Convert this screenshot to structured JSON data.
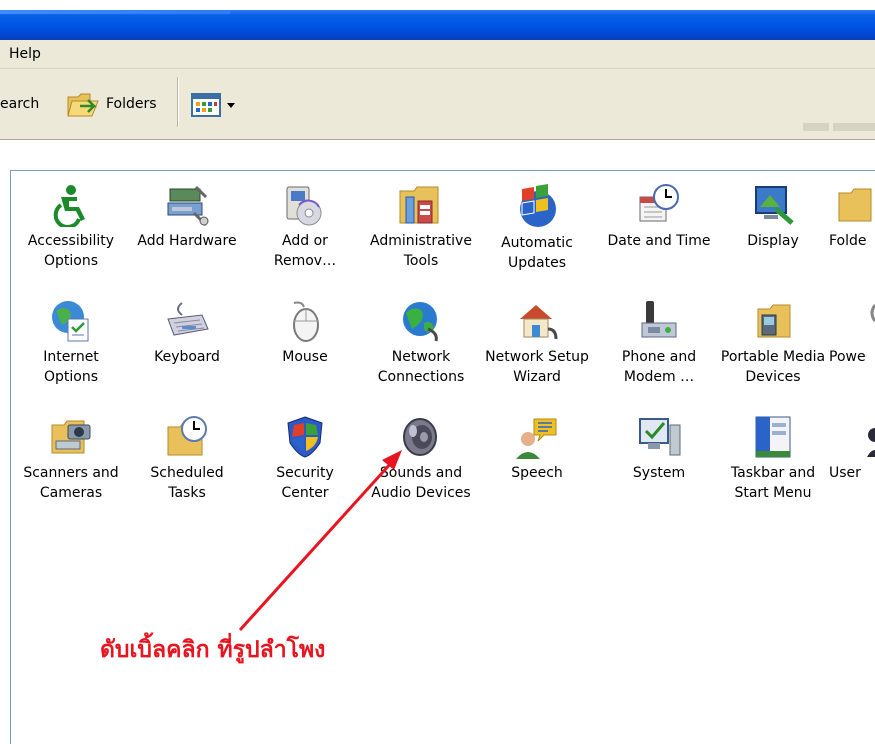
{
  "menubar": {
    "help": "Help"
  },
  "toolbar": {
    "search": "earch",
    "folders": "Folders"
  },
  "items": {
    "accessibility": "Accessibility\nOptions",
    "add_hardware": "Add Hardware",
    "add_remove": "Add or\nRemov…",
    "admin_tools": "Administrative\nTools",
    "auto_updates": "Automatic\nUpdates",
    "date_time": "Date and Time",
    "display": "Display",
    "folder_options": "Folde",
    "internet_options": "Internet\nOptions",
    "keyboard": "Keyboard",
    "mouse": "Mouse",
    "network_connections": "Network\nConnections",
    "network_setup": "Network Setup\nWizard",
    "phone_modem": "Phone and\nModem …",
    "portable_media": "Portable Media\nDevices",
    "power": "Powe",
    "scanners": "Scanners and\nCameras",
    "scheduled_tasks": "Scheduled\nTasks",
    "security_center": "Security\nCenter",
    "sounds_audio": "Sounds and\nAudio Devices",
    "speech": "Speech",
    "system": "System",
    "taskbar": "Taskbar and\nStart Menu",
    "user_accounts": "User"
  },
  "annotation": "ดับเบิ้ลคลิก ที่รูปลำโพง",
  "colors": {
    "titlebar": "#0055e5",
    "annotation": "#e8141f"
  }
}
